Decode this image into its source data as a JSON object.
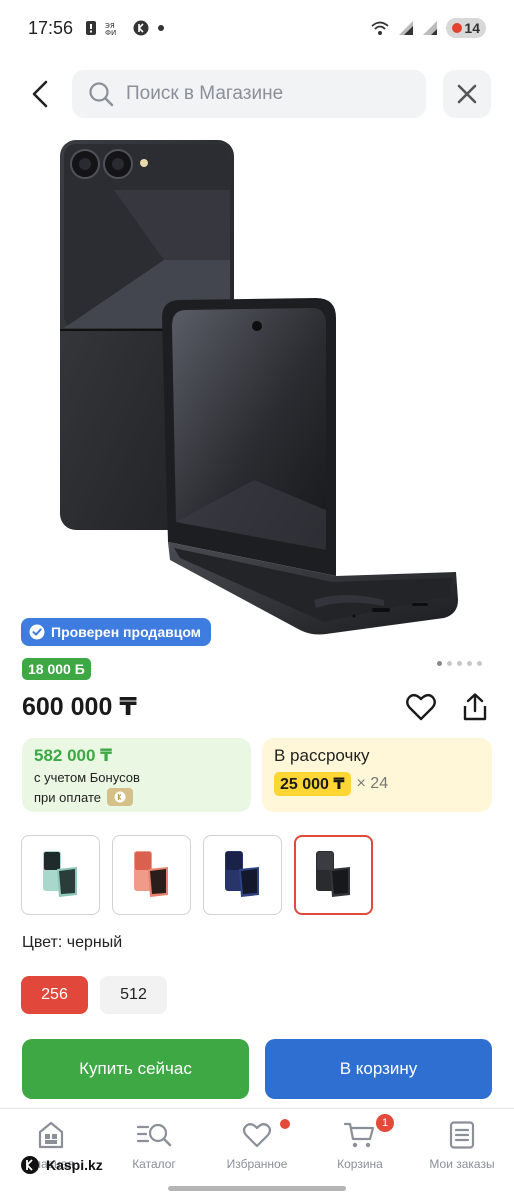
{
  "status_bar": {
    "time": "17:56",
    "battery": "14"
  },
  "search": {
    "placeholder": "Поиск в Магазине"
  },
  "product": {
    "verified_label": "Проверен продавцом",
    "bonus_badge": "18 000 Б",
    "price": "600 000 ₸",
    "gallery_pages": 5,
    "gallery_active": 1
  },
  "bonus_card": {
    "amount": "582 000 ₸",
    "line1": "с учетом Бонусов",
    "line2": "при оплате"
  },
  "installment_card": {
    "title": "В рассрочку",
    "monthly": "25 000 ₸",
    "multiplier": "× 24"
  },
  "variants": {
    "colors": [
      "mint",
      "peach",
      "navy",
      "black"
    ],
    "selected_index": 3
  },
  "color_label": "Цвет: черный",
  "memory": {
    "options": [
      "256",
      "512"
    ],
    "selected": "256"
  },
  "actions": {
    "buy_now": "Купить сейчас",
    "add_to_cart": "В корзину"
  },
  "bottom_nav": {
    "items": [
      {
        "label": "Главная",
        "icon": "home-icon"
      },
      {
        "label": "Каталог",
        "icon": "catalog-search-icon"
      },
      {
        "label": "Избранное",
        "icon": "heart-icon"
      },
      {
        "label": "Корзина",
        "icon": "cart-icon",
        "badge": "1"
      },
      {
        "label": "Мои заказы",
        "icon": "orders-icon"
      }
    ]
  },
  "watermark": "Kaspi.kz",
  "colors": {
    "green": "#3ea845",
    "blue": "#2f6fd1",
    "red": "#e34a3a",
    "yellow": "#ffd633"
  }
}
